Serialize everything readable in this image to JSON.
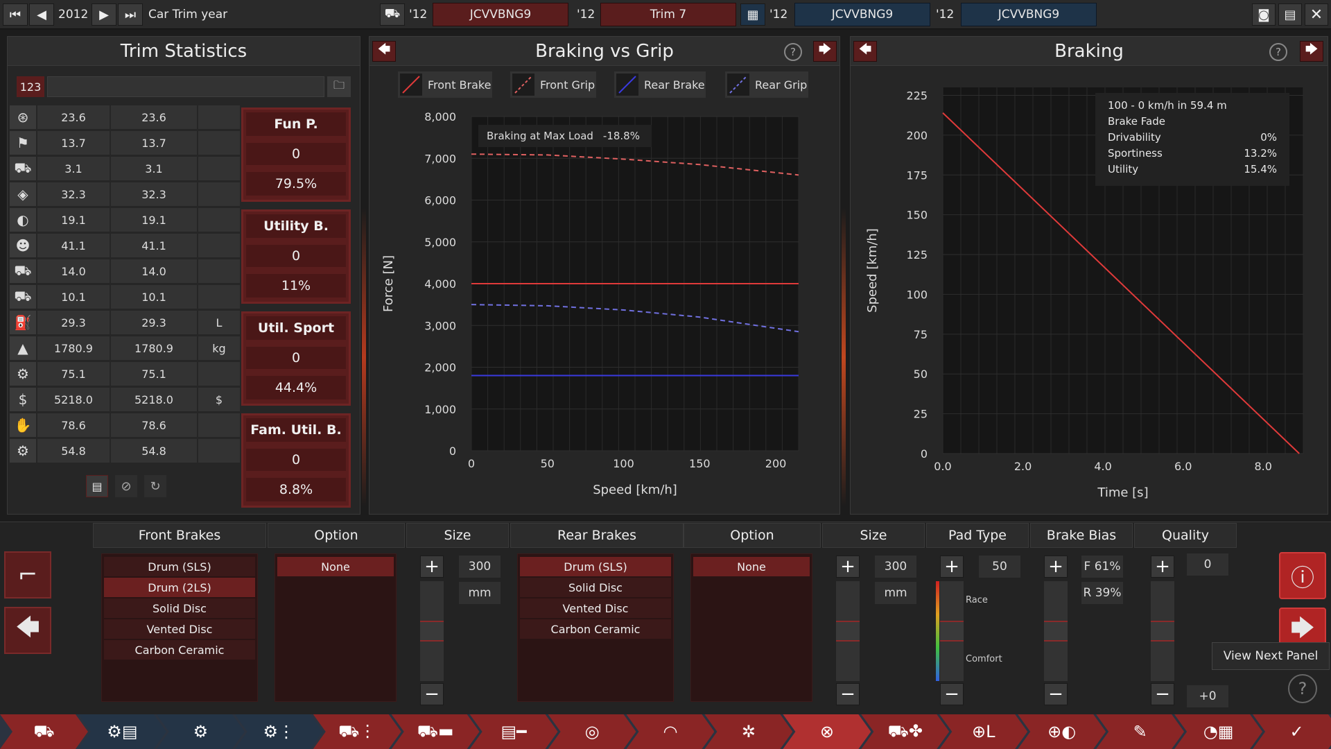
{
  "topbar": {
    "year": "2012",
    "year_label": "Car Trim year",
    "slots": [
      {
        "year": "'12",
        "name": "JCVVBNG9"
      },
      {
        "year": "'12",
        "name": "Trim 7"
      },
      {
        "year": "'12",
        "name": "JCVVBNG9"
      },
      {
        "year": "'12",
        "name": "JCVVBNG9"
      }
    ]
  },
  "trim_stats": {
    "title": "Trim Statistics",
    "search_prefix": "123",
    "search_value": "",
    "rows": [
      {
        "icon": "steering-wheel-icon",
        "a": "23.6",
        "b": "23.6",
        "unit": ""
      },
      {
        "icon": "checkered-flag-icon",
        "a": "13.7",
        "b": "13.7",
        "unit": ""
      },
      {
        "icon": "car-seat-icon",
        "a": "3.1",
        "b": "3.1",
        "unit": ""
      },
      {
        "icon": "shield-icon",
        "a": "32.3",
        "b": "32.3",
        "unit": ""
      },
      {
        "icon": "checker-badge-icon",
        "a": "19.1",
        "b": "19.1",
        "unit": ""
      },
      {
        "icon": "people-icon",
        "a": "41.1",
        "b": "41.1",
        "unit": ""
      },
      {
        "icon": "utility-car-icon",
        "a": "14.0",
        "b": "14.0",
        "unit": ""
      },
      {
        "icon": "offroad-car-icon",
        "a": "10.1",
        "b": "10.1",
        "unit": ""
      },
      {
        "icon": "fuel-icon",
        "a": "29.3",
        "b": "29.3",
        "unit": "L"
      },
      {
        "icon": "weight-icon",
        "a": "1780.9",
        "b": "1780.9",
        "unit": "kg"
      },
      {
        "icon": "wrench-car-icon",
        "a": "75.1",
        "b": "75.1",
        "unit": ""
      },
      {
        "icon": "money-bag-icon",
        "a": "5218.0",
        "b": "5218.0",
        "unit": "$"
      },
      {
        "icon": "hand-car-icon",
        "a": "78.6",
        "b": "78.6",
        "unit": ""
      },
      {
        "icon": "gear-tool-icon",
        "a": "54.8",
        "b": "54.8",
        "unit": ""
      }
    ],
    "scores": [
      {
        "title": "Fun P.",
        "value": "0",
        "percent": "79.5%"
      },
      {
        "title": "Utility B.",
        "value": "0",
        "percent": "11%"
      },
      {
        "title": "Util. Sport",
        "value": "0",
        "percent": "44.4%"
      },
      {
        "title": "Fam. Util. B.",
        "value": "0",
        "percent": "8.8%"
      }
    ]
  },
  "braking_grip": {
    "title": "Braking vs Grip",
    "legend": [
      "Front Brake",
      "Front Grip",
      "Rear Brake",
      "Rear Grip"
    ],
    "annotation_label": "Braking at Max Load",
    "annotation_value": "-18.8%"
  },
  "braking": {
    "title": "Braking",
    "info": [
      {
        "label": "100 - 0 km/h in 59.4 m",
        "value": ""
      },
      {
        "label": "Brake Fade",
        "value": ""
      },
      {
        "label": "Drivability",
        "value": "0%"
      },
      {
        "label": "Sportiness",
        "value": "13.2%"
      },
      {
        "label": "Utility",
        "value": "15.4%"
      }
    ]
  },
  "chart_data": [
    {
      "type": "line",
      "title": "Braking vs Grip",
      "xlabel": "Speed [km/h]",
      "ylabel": "Force [N]",
      "xlim": [
        0,
        215
      ],
      "ylim": [
        0,
        8000
      ],
      "xticks": [
        0,
        50,
        100,
        150,
        200
      ],
      "yticks": [
        "0",
        "1,000",
        "2,000",
        "3,000",
        "4,000",
        "5,000",
        "6,000",
        "7,000",
        "8,000"
      ],
      "yticks_values": [
        0,
        1000,
        2000,
        3000,
        4000,
        5000,
        6000,
        7000,
        8000
      ],
      "series": [
        {
          "name": "Front Brake",
          "color": "#e03a3a",
          "dash": false,
          "x": [
            0,
            215
          ],
          "y": [
            4000,
            4000
          ]
        },
        {
          "name": "Front Grip",
          "color": "#e06060",
          "dash": true,
          "x": [
            0,
            50,
            100,
            150,
            215
          ],
          "y": [
            7100,
            7080,
            6980,
            6850,
            6600
          ]
        },
        {
          "name": "Rear Brake",
          "color": "#3a3ae0",
          "dash": false,
          "x": [
            0,
            215
          ],
          "y": [
            1800,
            1800
          ]
        },
        {
          "name": "Rear Grip",
          "color": "#7070e0",
          "dash": true,
          "x": [
            0,
            50,
            100,
            150,
            215
          ],
          "y": [
            3500,
            3470,
            3370,
            3200,
            2850
          ]
        }
      ]
    },
    {
      "type": "line",
      "title": "Braking",
      "xlabel": "Time [s]",
      "ylabel": "Speed [km/h]",
      "xlim": [
        0,
        9
      ],
      "ylim": [
        0,
        230
      ],
      "xticks": [
        "0.0",
        "2.0",
        "4.0",
        "6.0",
        "8.0"
      ],
      "xticks_values": [
        0,
        2,
        4,
        6,
        8
      ],
      "yticks": [
        0,
        25,
        50,
        75,
        100,
        125,
        150,
        175,
        200,
        225
      ],
      "series": [
        {
          "name": "",
          "color": "#e03a3a",
          "dash": false,
          "x": [
            0,
            8.9
          ],
          "y": [
            214,
            0
          ]
        }
      ]
    }
  ],
  "bottom": {
    "front_brakes": {
      "header": "Front Brakes",
      "items": [
        "Drum (SLS)",
        "Drum (2LS)",
        "Solid Disc",
        "Vented Disc",
        "Carbon Ceramic"
      ],
      "selected": 1
    },
    "front_option": {
      "header": "Option",
      "items": [
        "None"
      ],
      "selected": 0
    },
    "front_size": {
      "header": "Size",
      "value": "300",
      "unit": "mm",
      "level": 0.5
    },
    "rear_brakes": {
      "header": "Rear Brakes",
      "items": [
        "Drum (SLS)",
        "Solid Disc",
        "Vented Disc",
        "Carbon Ceramic"
      ],
      "selected": 0
    },
    "rear_option": {
      "header": "Option",
      "items": [
        "None"
      ],
      "selected": 0
    },
    "rear_size": {
      "header": "Size",
      "value": "300",
      "unit": "mm",
      "level": 0.5
    },
    "pad_type": {
      "header": "Pad Type",
      "value": "50",
      "top_label": "Race",
      "bottom_label": "Comfort",
      "level": 0.5
    },
    "brake_bias": {
      "header": "Brake Bias",
      "front": "F 61%",
      "rear": "R 39%",
      "level": 0.5
    },
    "quality": {
      "header": "Quality",
      "value": "0",
      "bottom_value": "+0",
      "level": 0.5
    },
    "tooltip": "View Next Panel"
  },
  "navbar": {
    "tabs": [
      {
        "icon": "car-body-icon",
        "color": "#8a2525"
      },
      {
        "icon": "engine-file-icon",
        "color": "#243446"
      },
      {
        "icon": "engine-icon",
        "color": "#243446"
      },
      {
        "icon": "engine-settings-icon",
        "color": "#243446"
      },
      {
        "icon": "car-settings-icon",
        "color": "#8a2525"
      },
      {
        "icon": "chassis-icon",
        "color": "#8a2525"
      },
      {
        "icon": "suspension-icon",
        "color": "#8a2525"
      },
      {
        "icon": "drivetrain-icon",
        "color": "#8a2525"
      },
      {
        "icon": "gauge-icon",
        "color": "#8a2525"
      },
      {
        "icon": "wheel-icon",
        "color": "#8a2525"
      },
      {
        "icon": "brake-disc-icon",
        "color": "#b03030"
      },
      {
        "icon": "aero-icon",
        "color": "#8a2525"
      },
      {
        "icon": "interior-icon",
        "color": "#8a2525"
      },
      {
        "icon": "safety-icon",
        "color": "#8a2525"
      },
      {
        "icon": "tune-icon",
        "color": "#8a2525"
      },
      {
        "icon": "test-track-icon",
        "color": "#8a2525"
      },
      {
        "icon": "checkmark-icon",
        "color": "#8a2525"
      }
    ]
  }
}
